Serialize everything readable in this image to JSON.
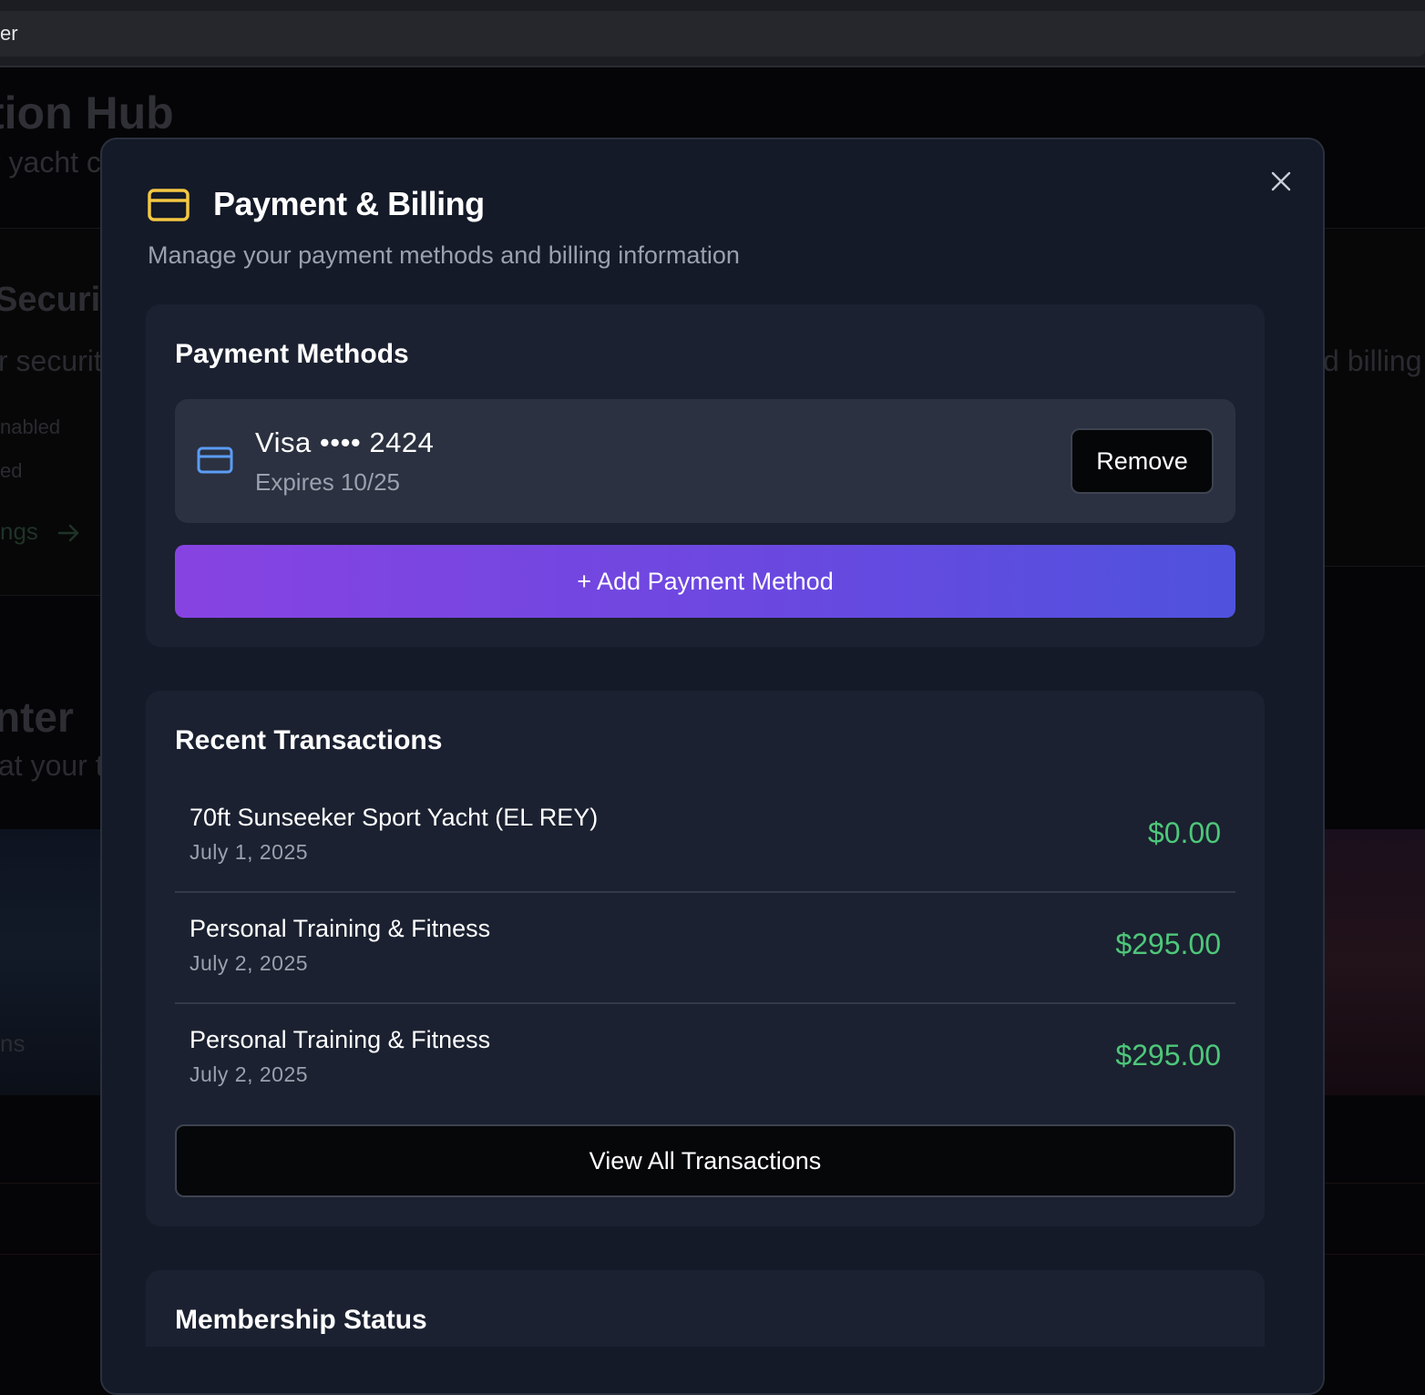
{
  "background": {
    "tab_text": "er",
    "hero_title": "tion Hub",
    "hero_subtitle": "r yacht c",
    "security_title": "Securit",
    "security_subtitle": "r securit",
    "enabled_text": "nabled",
    "ed_text": "ed",
    "settings_link": "ngs",
    "billing_text": "d billing",
    "center_title": "nter",
    "center_subtitle": "at your t",
    "ns_text": "ns"
  },
  "modal": {
    "title": "Payment & Billing",
    "subtitle": "Manage your payment methods and billing information",
    "header_icon": "credit-card-icon",
    "accent_color": "#f5c842"
  },
  "payment_methods": {
    "title": "Payment Methods",
    "card": {
      "name": "Visa •••• 2424",
      "expires": "Expires 10/25",
      "icon": "credit-card-icon",
      "icon_color": "#5b9cf5"
    },
    "remove_label": "Remove",
    "add_label": "+ Add Payment Method"
  },
  "transactions": {
    "title": "Recent Transactions",
    "items": [
      {
        "name": "70ft Sunseeker Sport Yacht (EL REY)",
        "date": "July 1, 2025",
        "amount": "$0.00"
      },
      {
        "name": "Personal Training & Fitness",
        "date": "July 2, 2025",
        "amount": "$295.00"
      },
      {
        "name": "Personal Training & Fitness",
        "date": "July 2, 2025",
        "amount": "$295.00"
      }
    ],
    "amount_color": "#4ec77a",
    "view_all_label": "View All Transactions"
  },
  "membership": {
    "title": "Membership Status"
  }
}
